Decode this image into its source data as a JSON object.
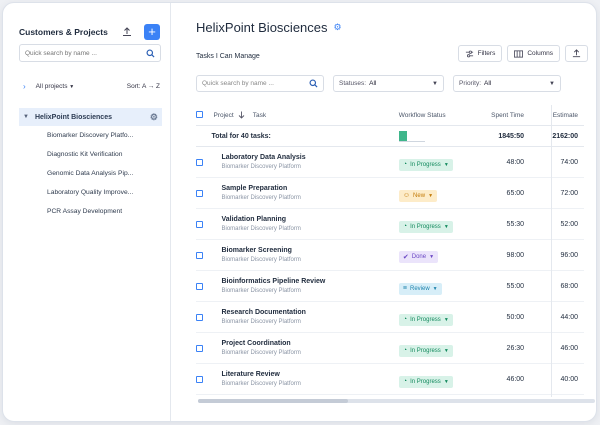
{
  "sidebar": {
    "title": "Customers & Projects",
    "search_placeholder": "Quick search by name ...",
    "filter_label": "All projects",
    "sort_label": "Sort:",
    "sort_value": "A → Z",
    "root": "HelixPoint Biosciences",
    "items": [
      {
        "label": "Biomarker Discovery Platfo..."
      },
      {
        "label": "Diagnostic Kit Verification"
      },
      {
        "label": "Genomic Data Analysis Pip..."
      },
      {
        "label": "Laboratory Quality Improve..."
      },
      {
        "label": "PCR Assay Development"
      }
    ]
  },
  "main": {
    "title": "HelixPoint Biosciences",
    "subtitle": "Tasks I Can Manage",
    "filters_btn": "Filters",
    "columns_btn": "Columns",
    "search_placeholder": "Quick search by name ...",
    "statuses_label": "Statuses:",
    "statuses_value": "All",
    "priority_label": "Priority:",
    "priority_value": "All"
  },
  "table": {
    "headers": {
      "project": "Project",
      "task": "Task",
      "status": "Workflow Status",
      "spent": "Spent Time",
      "estimate": "Estimate"
    },
    "total": {
      "label": "Total for 40 tasks:",
      "progress_fraction": 0.3,
      "spent": "1845:50",
      "estimate": "2162:00"
    },
    "rows": [
      {
        "name": "Laboratory Data Analysis",
        "project": "Biomarker Discovery Platform",
        "status": "In Progress",
        "status_kind": "progress",
        "spent": "48:00",
        "estimate": "74:00"
      },
      {
        "name": "Sample Preparation",
        "project": "Biomarker Discovery Platform",
        "status": "New",
        "status_kind": "new",
        "spent": "65:00",
        "estimate": "72:00"
      },
      {
        "name": "Validation Planning",
        "project": "Biomarker Discovery Platform",
        "status": "In Progress",
        "status_kind": "progress",
        "spent": "55:30",
        "estimate": "52:00"
      },
      {
        "name": "Biomarker Screening",
        "project": "Biomarker Discovery Platform",
        "status": "Done",
        "status_kind": "done",
        "spent": "98:00",
        "estimate": "96:00"
      },
      {
        "name": "Bioinformatics Pipeline Review",
        "project": "Biomarker Discovery Platform",
        "status": "Review",
        "status_kind": "review",
        "spent": "55:00",
        "estimate": "68:00"
      },
      {
        "name": "Research Documentation",
        "project": "Biomarker Discovery Platform",
        "status": "In Progress",
        "status_kind": "progress",
        "spent": "50:00",
        "estimate": "44:00"
      },
      {
        "name": "Project Coordination",
        "project": "Biomarker Discovery Platform",
        "status": "In Progress",
        "status_kind": "progress",
        "spent": "26:30",
        "estimate": "46:00"
      },
      {
        "name": "Literature Review",
        "project": "Biomarker Discovery Platform",
        "status": "In Progress",
        "status_kind": "progress",
        "spent": "46:00",
        "estimate": "40:00"
      }
    ]
  }
}
